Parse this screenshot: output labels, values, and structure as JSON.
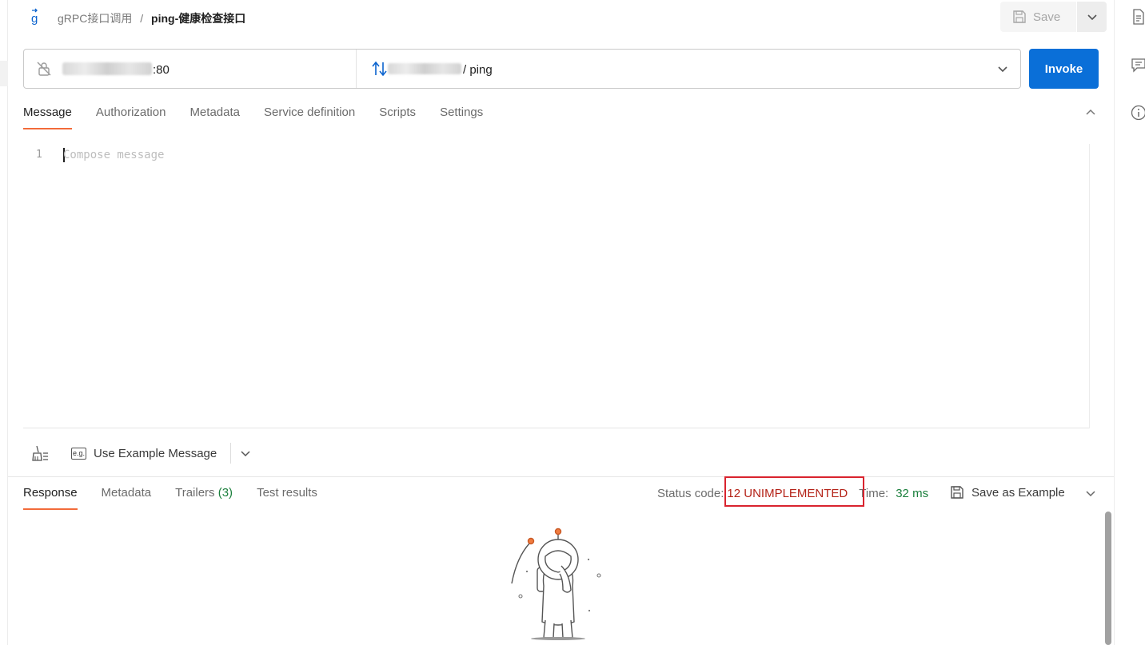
{
  "header": {
    "collection": "gRPC接口调用",
    "separator": "/",
    "request_name": "ping-健康检查接口",
    "save_label": "Save"
  },
  "url_bar": {
    "port": ":80",
    "method_path": "/ ping"
  },
  "invoke_label": "Invoke",
  "request_tabs": [
    "Message",
    "Authorization",
    "Metadata",
    "Service definition",
    "Scripts",
    "Settings"
  ],
  "editor": {
    "line_number": "1",
    "placeholder": "Compose message"
  },
  "editor_toolbar": {
    "example_icon": "e.g.",
    "use_example_label": "Use Example Message"
  },
  "response_tabs": {
    "response": "Response",
    "metadata": "Metadata",
    "trailers": "Trailers",
    "trailers_count": "(3)",
    "test_results": "Test results"
  },
  "response_status": {
    "status_label": "Status code:",
    "status_value": "12 UNIMPLEMENTED",
    "time_label": "Time:",
    "time_value": "32 ms",
    "save_example_label": "Save as Example"
  },
  "colors": {
    "primary": "#0a6fd8",
    "active_tab_underline": "#f26b3a",
    "status_error": "#b42318",
    "time_ok": "#1a7f3c",
    "highlight_box": "#d9232e"
  }
}
